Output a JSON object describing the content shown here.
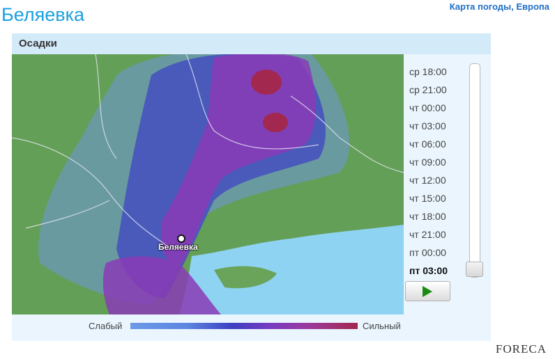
{
  "page": {
    "title": "Беляевка",
    "top_link": "Карта погоды, Европа"
  },
  "panel": {
    "title": "Осадки"
  },
  "map": {
    "city_label": "Беляевка"
  },
  "timeline": {
    "items": [
      "ср 18:00",
      "ср 21:00",
      "чт 00:00",
      "чт 03:00",
      "чт 06:00",
      "чт 09:00",
      "чт 12:00",
      "чт 15:00",
      "чт 18:00",
      "чт 21:00",
      "пт 00:00",
      "пт 03:00"
    ],
    "active_index": 11,
    "play_icon": "play-icon"
  },
  "legend": {
    "weak": "Слабый",
    "strong": "Сильный",
    "colors": [
      "#6c9ae8",
      "#3d3fc2",
      "#7a3bc0",
      "#a3284f"
    ]
  },
  "brand": {
    "logo": "FORECA"
  }
}
